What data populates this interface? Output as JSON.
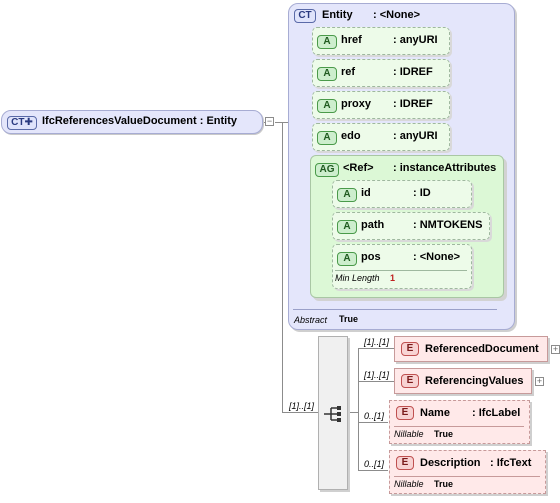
{
  "root": {
    "tag": "CT",
    "label": "IfcReferencesValueDocument : Entity"
  },
  "entity": {
    "tag": "CT",
    "name": "Entity",
    "type": ": <None>",
    "footer_label": "Abstract",
    "footer_value": "True",
    "attributes": [
      {
        "tag": "A",
        "name": "href",
        "type": ": anyURI"
      },
      {
        "tag": "A",
        "name": "ref",
        "type": ": IDREF"
      },
      {
        "tag": "A",
        "name": "proxy",
        "type": ": IDREF"
      },
      {
        "tag": "A",
        "name": "edo",
        "type": ": anyURI"
      }
    ],
    "group": {
      "tag": "AG",
      "name": "<Ref>",
      "type": ": instanceAttributes",
      "attributes": [
        {
          "tag": "A",
          "name": "id",
          "type": ": ID"
        },
        {
          "tag": "A",
          "name": "path",
          "type": ": NMTOKENS"
        },
        {
          "tag": "A",
          "name": "pos",
          "type": ": <None>",
          "facet_label": "Min Length",
          "facet_value": "1"
        }
      ]
    }
  },
  "sequence": {
    "multiplicity": "[1]..[1]"
  },
  "elements": [
    {
      "tag": "E",
      "name": "ReferencedDocument",
      "multiplicity": "[1]..[1]"
    },
    {
      "tag": "E",
      "name": "ReferencingValues",
      "multiplicity": "[1]..[1]"
    },
    {
      "tag": "E",
      "name": "Name",
      "type": ": IfcLabel",
      "multiplicity": "0..[1]",
      "facet_label": "Nillable",
      "facet_value": "True"
    },
    {
      "tag": "E",
      "name": "Description",
      "type": ": IfcText",
      "multiplicity": "0..[1]",
      "facet_label": "Nillable",
      "facet_value": "True"
    }
  ],
  "colors": {
    "complex_type_fill": "#e4e6fb",
    "attribute_fill": "#edfbe9",
    "element_fill": "#ffe9e9",
    "connector": "#8c8c8c"
  }
}
